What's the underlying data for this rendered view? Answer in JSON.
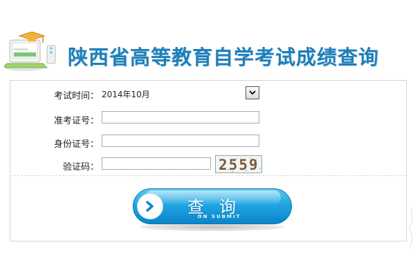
{
  "header": {
    "title": "陕西省高等教育自学考试成绩查询"
  },
  "form": {
    "exam_time": {
      "label": "考试时间：",
      "selected": "2014年10月"
    },
    "admission_no": {
      "label": "准考证号：",
      "value": ""
    },
    "id_no": {
      "label": "身份证号：",
      "value": ""
    },
    "captcha": {
      "label": "验证码：",
      "value": "",
      "image_text": "2559"
    }
  },
  "submit": {
    "label": "查询",
    "sublabel": "ON SUBMIT"
  },
  "colors": {
    "title": "#1f7fb9",
    "button": "#21a5e3",
    "border": "#d4d4d4"
  }
}
